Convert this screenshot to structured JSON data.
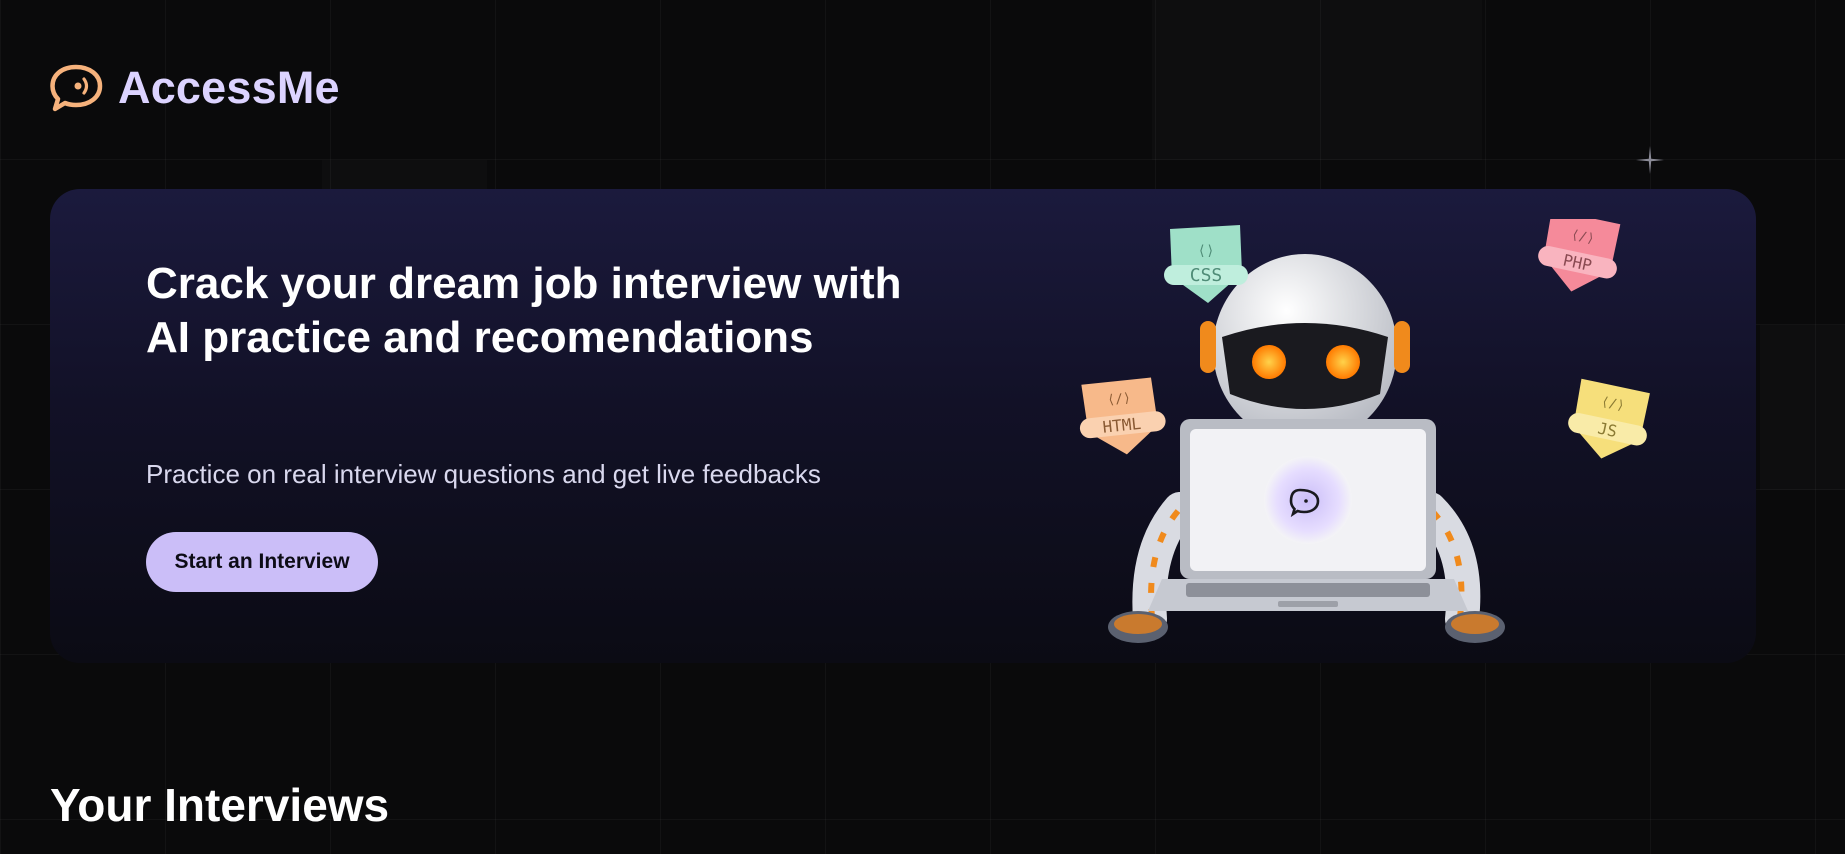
{
  "brand": {
    "name": "AccessMe",
    "logo_icon": "chat-bubble-icon",
    "accent_color": "#f6b27c",
    "name_color": "#dcd3ff"
  },
  "hero": {
    "title": "Crack your dream job interview with AI practice and recomendations",
    "subtitle": "Practice on real interview questions and get live feedbacks",
    "cta_label": "Start an Interview",
    "cta_color": "#cbbef8",
    "badges": [
      {
        "label": "CSS",
        "color": "#9fe0c8"
      },
      {
        "label": "PHP",
        "color": "#f58a9a"
      },
      {
        "label": "HTML",
        "color": "#f7b98a"
      },
      {
        "label": "JS",
        "color": "#f6df7b"
      }
    ]
  },
  "sections": {
    "interviews_title": "Your Interviews"
  }
}
